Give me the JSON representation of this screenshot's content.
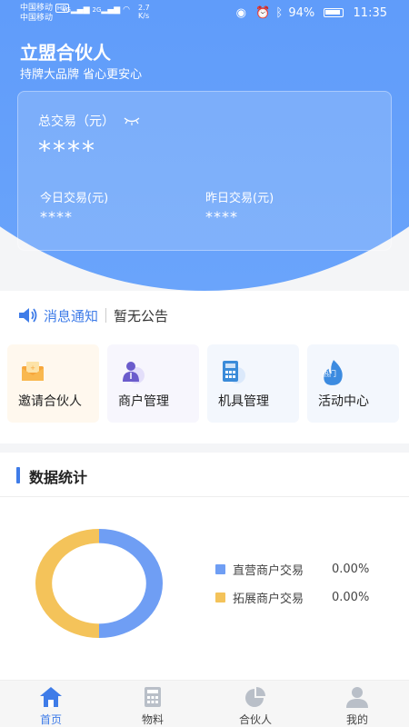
{
  "status_bar": {
    "carrier_1": "中国移动",
    "carrier_2": "中国移动",
    "hd": "HD",
    "network_1": "4G",
    "network_2": "2G",
    "speed_value": "2.7",
    "speed_unit": "K/s",
    "battery_percent": "94%",
    "time": "11:35"
  },
  "header": {
    "title": "立盟合伙人",
    "subtitle": "持牌大品牌 省心更安心"
  },
  "stats": {
    "total_label": "总交易（元）",
    "total_value": "****",
    "today_label": "今日交易(元)",
    "today_value": "****",
    "yesterday_label": "昨日交易(元)",
    "yesterday_value": "****"
  },
  "notice": {
    "label": "消息通知",
    "text": "暂无公告"
  },
  "quick_actions": [
    {
      "label": "邀请合伙人",
      "icon": "invite-envelope-icon"
    },
    {
      "label": "商户管理",
      "icon": "merchant-person-icon"
    },
    {
      "label": "机具管理",
      "icon": "pos-calculator-icon"
    },
    {
      "label": "活动中心",
      "icon": "hot-flame-icon",
      "badge": "热门"
    }
  ],
  "data_section": {
    "title": "数据统计"
  },
  "chart_data": {
    "type": "pie",
    "series": [
      {
        "name": "直营商户交易",
        "value": "0.00%",
        "color": "#6f9ef4"
      },
      {
        "name": "拓展商户交易",
        "value": "0.00%",
        "color": "#f4c35a"
      }
    ]
  },
  "tabs": [
    {
      "label": "首页",
      "icon": "home-icon",
      "active": true
    },
    {
      "label": "物料",
      "icon": "calculator-icon",
      "active": false
    },
    {
      "label": "合伙人",
      "icon": "pie-chart-icon",
      "active": false
    },
    {
      "label": "我的",
      "icon": "user-icon",
      "active": false
    }
  ],
  "colors": {
    "primary": "#4f8ff7",
    "accent_text": "#3f7ce8",
    "series_a": "#6f9ef4",
    "series_b": "#f4c35a"
  }
}
